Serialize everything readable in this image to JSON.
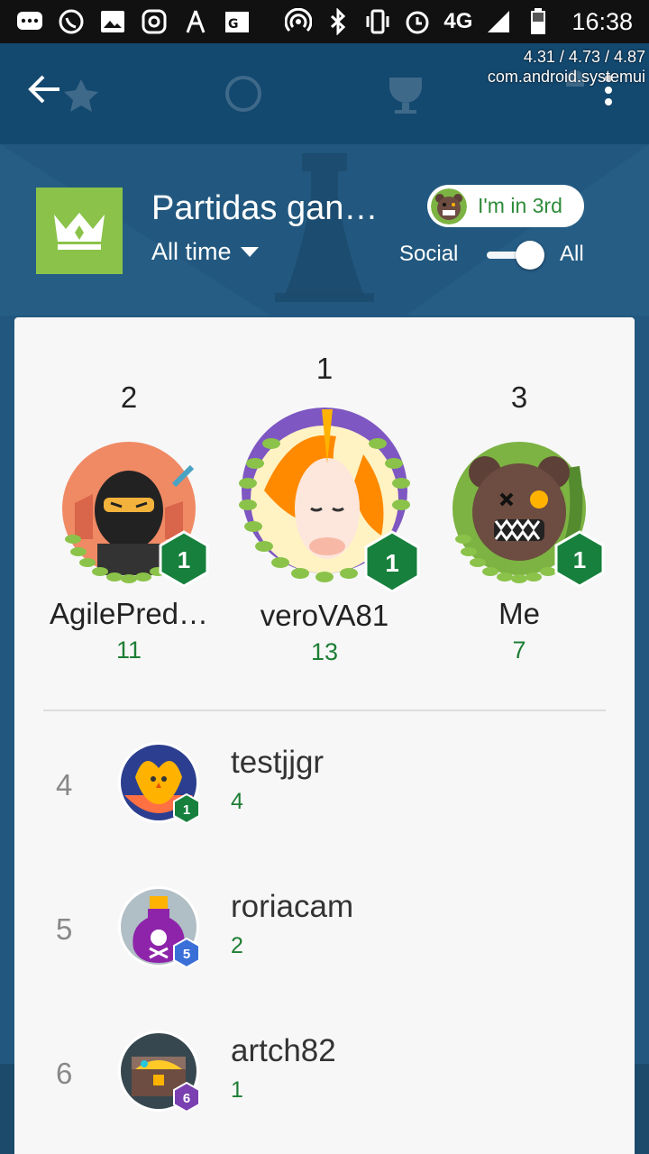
{
  "status_bar": {
    "time": "16:38",
    "network": "4G",
    "icons_left": [
      "messages-icon",
      "whatsapp-icon",
      "gallery-icon",
      "instagram-icon",
      "activity-icon",
      "maps-icon"
    ],
    "icons_right": [
      "hotspot-icon",
      "bluetooth-icon",
      "vibrate-icon",
      "alarm-icon",
      "network-4g-icon",
      "signal-icon",
      "battery-icon"
    ]
  },
  "debug": {
    "load": "4.31 / 4.73 / 4.87",
    "process": "com.android.systemui"
  },
  "header": {
    "title": "Partidas gan…",
    "period": "All time",
    "rank_chip": "I'm in 3rd",
    "scope_social": "Social",
    "scope_all": "All",
    "scope_selected": "All",
    "accent_color": "#8bc34a"
  },
  "podium": [
    {
      "rank": "1",
      "name": "veroVA81",
      "score": "13",
      "level": "1"
    },
    {
      "rank": "2",
      "name": "AgilePred…",
      "score": "11",
      "level": "1"
    },
    {
      "rank": "3",
      "name": "Me",
      "score": "7",
      "level": "1"
    }
  ],
  "list": [
    {
      "rank": "4",
      "name": "testjjgr",
      "score": "4",
      "level": "1"
    },
    {
      "rank": "5",
      "name": "roriacam",
      "score": "2",
      "level": "5"
    },
    {
      "rank": "6",
      "name": "artch82",
      "score": "1",
      "level": "6"
    }
  ],
  "colors": {
    "app_bar": "#13486f",
    "background": "#22587f",
    "score_green": "#1e7e34",
    "badge_green": "#16803c",
    "badge_blue": "#3a6fd8",
    "badge_purple": "#7a3fb0"
  }
}
